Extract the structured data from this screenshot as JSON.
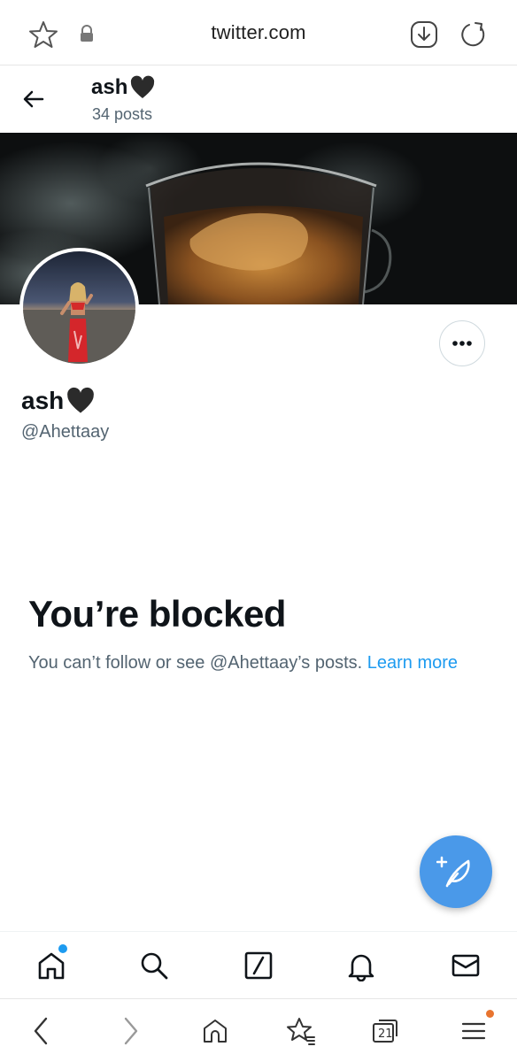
{
  "browser": {
    "url": "twitter.com",
    "bottom_tabs_count": "21"
  },
  "header": {
    "name": "ash",
    "posts": "34 posts"
  },
  "profile": {
    "name": "ash",
    "handle": "@Ahettaay"
  },
  "blocked": {
    "title": "You’re blocked",
    "message": "You can’t follow or see @Ahettaay’s posts.",
    "link": "Learn more"
  },
  "nav": {
    "items": [
      "home-icon",
      "search-icon",
      "grok-icon",
      "notifications-icon",
      "messages-icon"
    ]
  },
  "colors": {
    "accent": "#1d9bf0",
    "fab": "#4a99e9",
    "text": "#0f1419",
    "secondary": "#536471"
  }
}
